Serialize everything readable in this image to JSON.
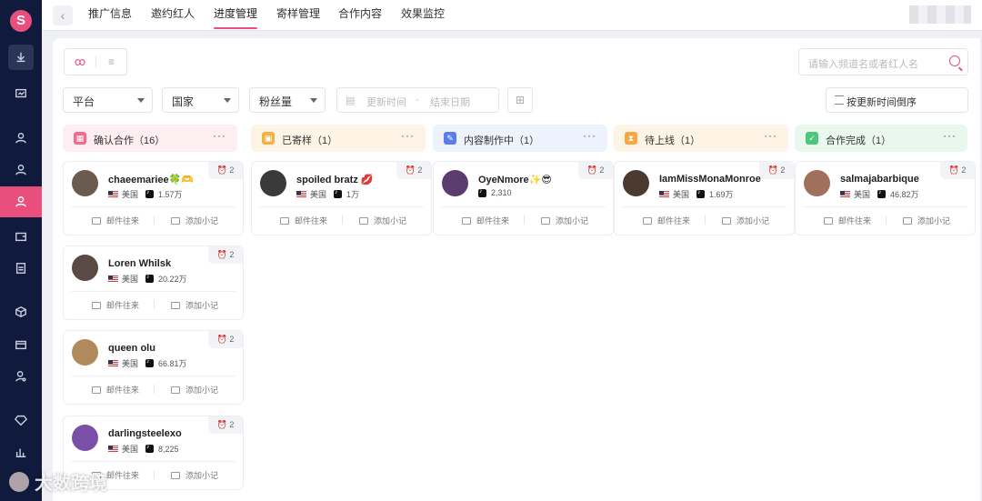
{
  "colors": {
    "accent": "#e84f7c",
    "sidebar": "#0f1a3c"
  },
  "logo": "S",
  "sidebar": {
    "icons": [
      "download-icon",
      "monitor-icon",
      "user-icon",
      "user-icon",
      "user-active-icon",
      "wallet-icon",
      "report-icon",
      "box-icon",
      "package-icon",
      "user-settings-icon",
      "diamond-icon",
      "chart-icon"
    ]
  },
  "topbar": {
    "back": "‹",
    "tabs": [
      "推广信息",
      "邀约红人",
      "进度管理",
      "寄样管理",
      "合作内容",
      "效果监控"
    ],
    "active_tab": "进度管理"
  },
  "toolbar": {
    "view_kanban": "ꝏ",
    "view_list": "≡",
    "search_placeholder": "请输入频道名或者红人名",
    "filter_platform": "平台",
    "filter_country": "国家",
    "filter_fans": "粉丝量",
    "date_start": "更新时间",
    "date_sep": "-",
    "date_end": "结束日期",
    "sort_label": "按更新时间倒序"
  },
  "columns": [
    {
      "title": "确认合作（16）",
      "icon": "handshake-icon",
      "icon_glyph": "▦",
      "bg": "#fdeef2",
      "icon_bg": "#f06c8f"
    },
    {
      "title": "已寄样（1）",
      "icon": "gift-icon",
      "icon_glyph": "▣",
      "bg": "#fdf4e6",
      "icon_bg": "#f5b041"
    },
    {
      "title": "内容制作中（1）",
      "icon": "content-icon",
      "icon_glyph": "✎",
      "bg": "#eef2fd",
      "icon_bg": "#5b7cf0"
    },
    {
      "title": "待上线（1）",
      "icon": "hourglass-icon",
      "icon_glyph": "⧗",
      "bg": "#fdf4e6",
      "icon_bg": "#f5a742"
    },
    {
      "title": "合作完成（1）",
      "icon": "check-icon",
      "icon_glyph": "✓",
      "bg": "#eaf7ef",
      "icon_bg": "#4ec77a"
    }
  ],
  "more": "···",
  "cards": [
    {
      "name": "chaeemariee🍀🫶",
      "country": "美国",
      "fans": "1.57万",
      "badge": "⏰ 2",
      "avatar": "#6b5a4e"
    },
    {
      "name": "spoiled bratz 💋",
      "country": "美国",
      "fans": "1万",
      "badge": "⏰ 2",
      "avatar": "#3a3a3a"
    },
    {
      "name": "OyeNmore✨😎",
      "country": "",
      "fans": "2,310",
      "badge": "⏰ 2",
      "avatar": "#5a3d6e"
    },
    {
      "name": "IamMissMonaMonroe",
      "country": "美国",
      "fans": "1.69万",
      "badge": "⏰ 2",
      "avatar": "#4a3a30"
    },
    {
      "name": "salmajabarbique",
      "country": "美国",
      "fans": "46.82万",
      "badge": "⏰ 2",
      "avatar": "#a0705a"
    },
    {
      "name": "Loren Whilsk",
      "country": "美国",
      "fans": "20.22万",
      "badge": "⏰ 2",
      "avatar": "#5a4a44"
    },
    {
      "name": "queen olu",
      "country": "美国",
      "fans": "66.81万",
      "badge": "⏰ 2",
      "avatar": "#b08a5a"
    },
    {
      "name": "darlingsteelexo",
      "country": "美国",
      "fans": "8,225",
      "badge": "⏰ 2",
      "avatar": "#7a4fa8"
    }
  ],
  "card_actions": {
    "mail": "邮件往来",
    "note": "添加小记"
  },
  "watermark": "大数跨境"
}
